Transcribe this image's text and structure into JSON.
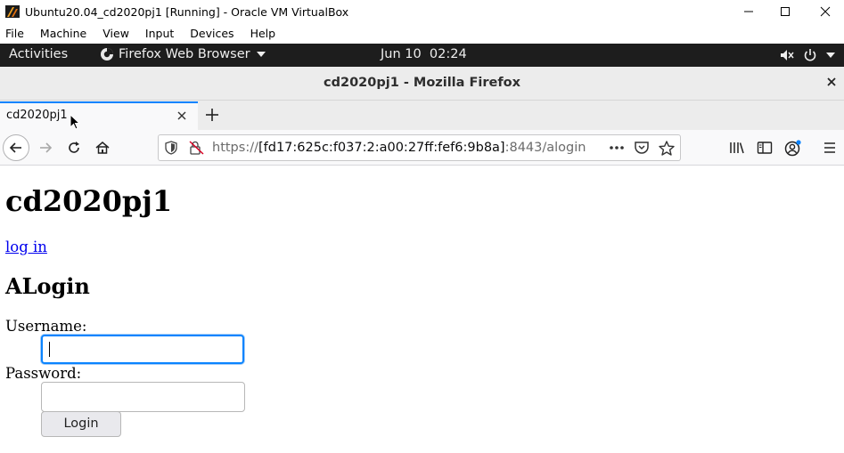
{
  "vbox": {
    "title": "Ubuntu20.04_cd2020pj1 [Running] - Oracle VM VirtualBox",
    "menus": [
      "File",
      "Machine",
      "View",
      "Input",
      "Devices",
      "Help"
    ]
  },
  "gnome": {
    "activities": "Activities",
    "app_name": "Firefox Web Browser",
    "clock": "Jun 10  02:24"
  },
  "firefox": {
    "window_title": "cd2020pj1 - Mozilla Firefox",
    "tab_title": "cd2020pj1",
    "url_prefix": "https://",
    "url_host": "[fd17:625c:f037:2:a00:27ff:fef6:9b8a]",
    "url_rest": ":8443/alogin"
  },
  "page": {
    "heading": "cd2020pj1",
    "login_link": "log in",
    "subheading": "ALogin",
    "username_label": "Username:",
    "username_value": "",
    "password_label": "Password:",
    "password_value": "",
    "login_button": "Login"
  },
  "colors": {
    "accent": "#0a84ff",
    "link": "#0000ee",
    "gnome_bar": "#1d1d1d"
  }
}
